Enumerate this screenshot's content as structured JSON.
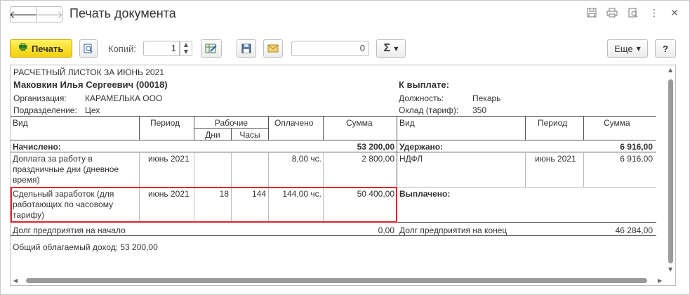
{
  "window": {
    "title": "Печать документа",
    "nav_back": "🡐",
    "nav_forward": "🡒"
  },
  "title_icons": [
    "save-icon",
    "print-icon",
    "preview-icon",
    "more-icon",
    "close-icon"
  ],
  "toolbar": {
    "print_label": "Печать",
    "copies_label": "Копий:",
    "copies_value": "1",
    "sum_value": "0",
    "sigma_label": "Σ",
    "more_label": "Еще",
    "help_label": "?"
  },
  "doc": {
    "heading": "РАСЧЕТНЫЙ ЛИСТОК ЗА ИЮНЬ 2021",
    "employee": "Маковкин Илья Сергеевич (00018)",
    "to_pay_label": "К выплате:",
    "org_label": "Организация:",
    "org_value": "КАРАМЕЛЬКА ООО",
    "dept_label": "Подразделение:",
    "dept_value": "Цех",
    "position_label": "Должность:",
    "position_value": "Пекарь",
    "salary_label": "Оклад (тариф):",
    "salary_value": "350",
    "headers": {
      "vid": "Вид",
      "period": "Период",
      "work": "Рабочие",
      "days": "Дни",
      "hours": "Часы",
      "paid": "Оплачено",
      "sum": "Сумма",
      "vid2": "Вид",
      "period2": "Период",
      "sum2": "Сумма"
    },
    "accrued_label": "Начислено:",
    "accrued_total": "53 200,00",
    "withheld_label": "Удержано:",
    "withheld_total": "6 916,00",
    "row1": {
      "vid": "Доплата за работу в праздничные дни (дневное время)",
      "period": "июнь 2021",
      "days": "",
      "hours": "",
      "paid": "8,00 чс.",
      "sum": "2 800,00"
    },
    "row1_right": {
      "vid": "НДФЛ",
      "period": "июнь 2021",
      "sum": "6 916,00"
    },
    "row2": {
      "vid": "Сдельный заработок (для работающих по часовому тарифу)",
      "period": "июнь 2021",
      "days": "18",
      "hours": "144",
      "paid": "144,00 чс.",
      "sum": "50 400,00"
    },
    "paid_out_label": "Выплачено:",
    "debt_start_label": "Долг предприятия на начало",
    "debt_start_value": "0,00",
    "debt_end_label": "Долг предприятия на конец",
    "debt_end_value": "46 284,00",
    "taxable_income": "Общий облагаемый доход: 53 200,00"
  },
  "colors": {
    "print_button": "#f3cf0e",
    "highlight": "#e0242a"
  }
}
